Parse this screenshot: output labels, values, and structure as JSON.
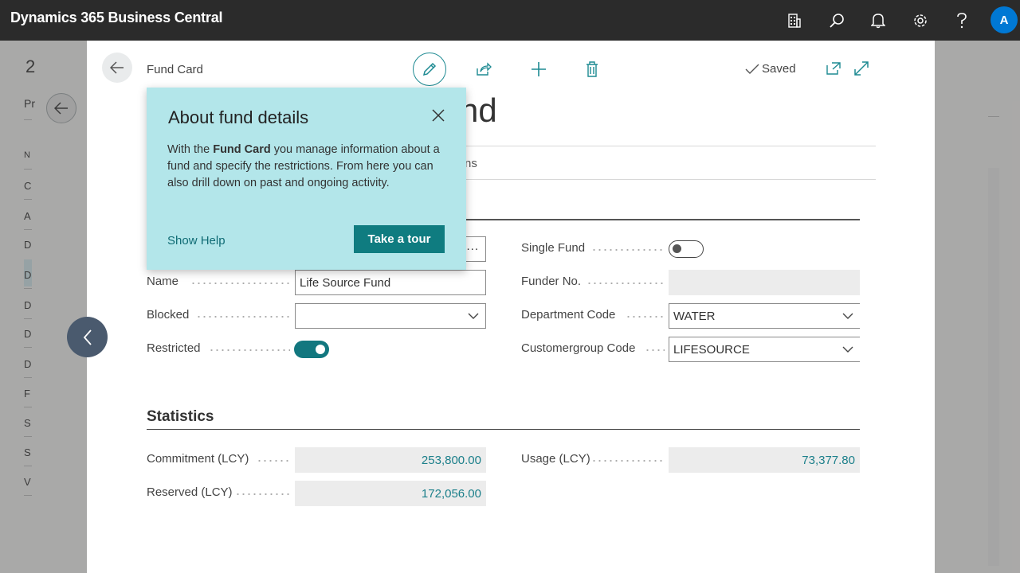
{
  "app": {
    "title": "Dynamics 365 Business Central",
    "avatar_initial": "A"
  },
  "background": {
    "title_fragment": "2",
    "section_fragment": "Pr",
    "list_fragments": [
      "N",
      "C",
      "A",
      "D",
      "D",
      "D",
      "D",
      "D",
      "F",
      "S",
      "S",
      "V"
    ]
  },
  "card": {
    "caption": "Fund Card",
    "saved_label": "Saved",
    "title_fragment": "nd",
    "tab_fragment": "ns"
  },
  "fields": {
    "name_label": "Name",
    "name_value": "Life Source Fund",
    "blocked_label": "Blocked",
    "blocked_value": "",
    "restricted_label": "Restricted",
    "restricted_on": true,
    "single_fund_label": "Single Fund",
    "single_fund_on": false,
    "funder_no_label": "Funder No.",
    "funder_no_value": "",
    "department_label": "Department Code",
    "department_value": "WATER",
    "customergroup_label": "Customergroup Code",
    "customergroup_value": "LIFESOURCE",
    "code_field_ellipsis": "..."
  },
  "statistics": {
    "title": "Statistics",
    "commitment_label": "Commitment (LCY)",
    "commitment_value": "253,800.00",
    "reserved_label": "Reserved (LCY)",
    "reserved_value": "172,056.00",
    "usage_label": "Usage (LCY)",
    "usage_value": "73,377.80"
  },
  "popup": {
    "title": "About fund details",
    "body_prefix": "With the ",
    "body_bold": "Fund Card",
    "body_suffix": " you manage information about a fund and specify the restrictions. From here you can also drill down on past and ongoing activity.",
    "show_help": "Show Help",
    "tour_button": "Take a tour"
  },
  "colors": {
    "accent": "#12777f",
    "popup_bg": "#b3e6ea",
    "topbar": "#2b2b2b"
  },
  "icons": [
    "building-icon",
    "search-icon",
    "bell-icon",
    "gear-icon",
    "help-icon",
    "back-arrow-icon",
    "edit-pencil-icon",
    "share-icon",
    "add-icon",
    "delete-icon",
    "checkmark-icon",
    "open-new-window-icon",
    "expand-icon",
    "close-icon",
    "chevron-down-icon",
    "chevron-left-icon"
  ]
}
